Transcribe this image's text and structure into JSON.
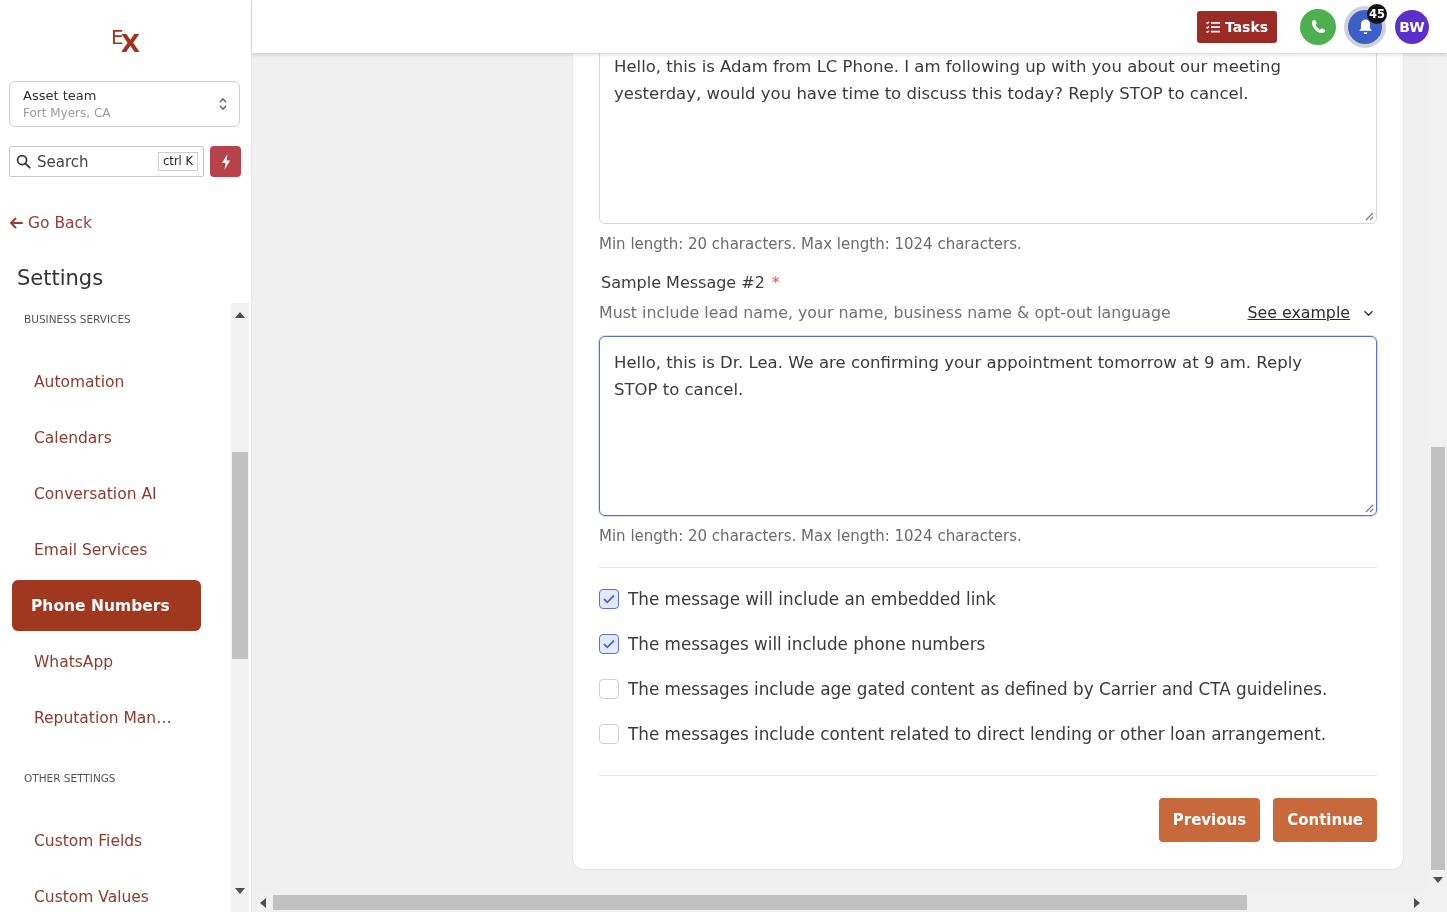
{
  "sidebar": {
    "logo": "EX",
    "location": {
      "name": "Asset team",
      "address": "Fort Myers, CA"
    },
    "search": {
      "placeholder": "Search",
      "shortcut": "ctrl K"
    },
    "back_link": "Go Back",
    "title": "Settings",
    "sections": [
      {
        "heading": "BUSINESS SERVICES",
        "items": [
          {
            "label": "Automation",
            "selected": false
          },
          {
            "label": "Calendars",
            "selected": false
          },
          {
            "label": "Conversation AI",
            "selected": false
          },
          {
            "label": "Email Services",
            "selected": false
          },
          {
            "label": "Phone Numbers",
            "selected": true
          },
          {
            "label": "WhatsApp",
            "selected": false
          },
          {
            "label": "Reputation Man…",
            "selected": false
          }
        ]
      },
      {
        "heading": "OTHER SETTINGS",
        "items": [
          {
            "label": "Custom Fields",
            "selected": false
          },
          {
            "label": "Custom Values",
            "selected": false
          }
        ]
      }
    ]
  },
  "topbar": {
    "tasks_button": "Tasks",
    "notification_count": "45",
    "avatar_initials": "BW"
  },
  "form": {
    "messages": [
      {
        "value": "Hello, this is Adam from LC Phone. I am following up with you about our meeting yesterday, would you have time to discuss this today? Reply STOP to cancel.",
        "hint": "Min length: 20 characters. Max length: 1024 characters.",
        "focused": false
      },
      {
        "label": "Sample Message #2",
        "required_mark": "*",
        "helper": "Must include lead name, your name, business name & opt-out language",
        "example_link": "See example",
        "value": "Hello, this is Dr. Lea. We are confirming your appointment tomorrow at 9 am. Reply STOP to cancel.",
        "hint": "Min length: 20 characters. Max length: 1024 characters.",
        "focused": true
      }
    ],
    "options": [
      {
        "label": "The message will include an embedded link",
        "checked": true
      },
      {
        "label": "The messages will include phone numbers",
        "checked": true
      },
      {
        "label": "The messages include age gated content as defined by Carrier and CTA guidelines.",
        "checked": false
      },
      {
        "label": "The messages include content related to direct lending or other loan arrangement.",
        "checked": false
      }
    ],
    "buttons": [
      {
        "label": "Previous"
      },
      {
        "label": "Continue"
      }
    ]
  }
}
